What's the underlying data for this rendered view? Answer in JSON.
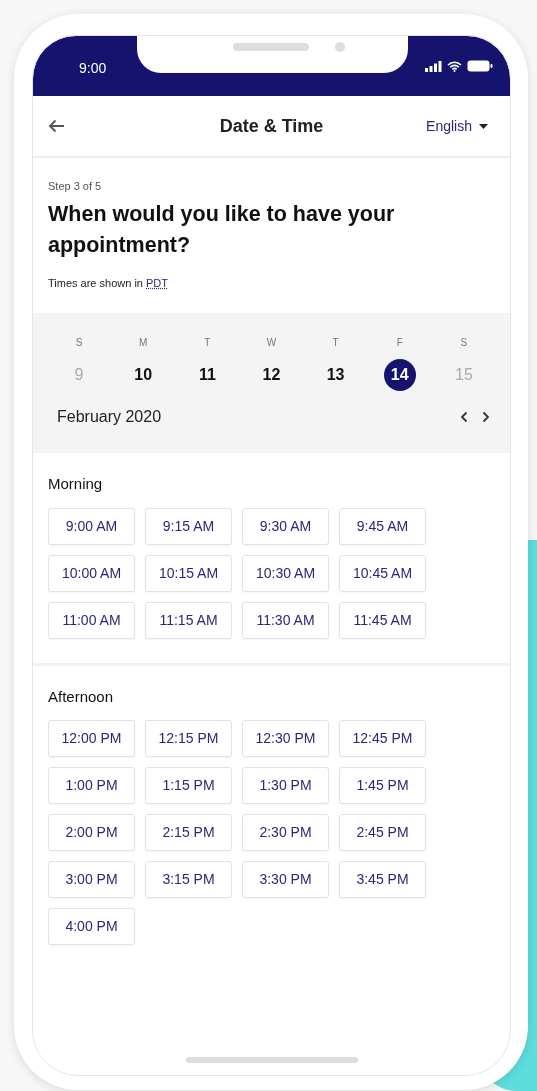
{
  "status_bar": {
    "time": "9:00"
  },
  "header": {
    "title": "Date & Time",
    "language": "English"
  },
  "intro": {
    "step": "Step 3 of 5",
    "heading": "When would you like to have your appointment?",
    "timezone_text": "Times are shown in",
    "timezone_link": "PDT"
  },
  "calendar": {
    "month": "February 2020",
    "days": [
      {
        "weekday": "S",
        "date": "9",
        "disabled": true,
        "selected": false
      },
      {
        "weekday": "M",
        "date": "10",
        "disabled": false,
        "selected": false
      },
      {
        "weekday": "T",
        "date": "11",
        "disabled": false,
        "selected": false
      },
      {
        "weekday": "W",
        "date": "12",
        "disabled": false,
        "selected": false
      },
      {
        "weekday": "T",
        "date": "13",
        "disabled": false,
        "selected": false
      },
      {
        "weekday": "F",
        "date": "14",
        "disabled": false,
        "selected": true
      },
      {
        "weekday": "S",
        "date": "15",
        "disabled": true,
        "selected": false
      }
    ]
  },
  "sections": [
    {
      "title": "Morning",
      "slots": [
        "9:00 AM",
        "9:15 AM",
        "9:30 AM",
        "9:45 AM",
        "10:00 AM",
        "10:15 AM",
        "10:30 AM",
        "10:45 AM",
        "11:00 AM",
        "11:15 AM",
        "11:30 AM",
        "11:45 AM"
      ]
    },
    {
      "title": "Afternoon",
      "slots": [
        "12:00 PM",
        "12:15 PM",
        "12:30 PM",
        "12:45 PM",
        "1:00 PM",
        "1:15 PM",
        "1:30 PM",
        "1:45 PM",
        "2:00 PM",
        "2:15 PM",
        "2:30 PM",
        "2:45 PM",
        "3:00 PM",
        "3:15 PM",
        "3:30 PM",
        "3:45 PM",
        "4:00 PM"
      ]
    }
  ]
}
